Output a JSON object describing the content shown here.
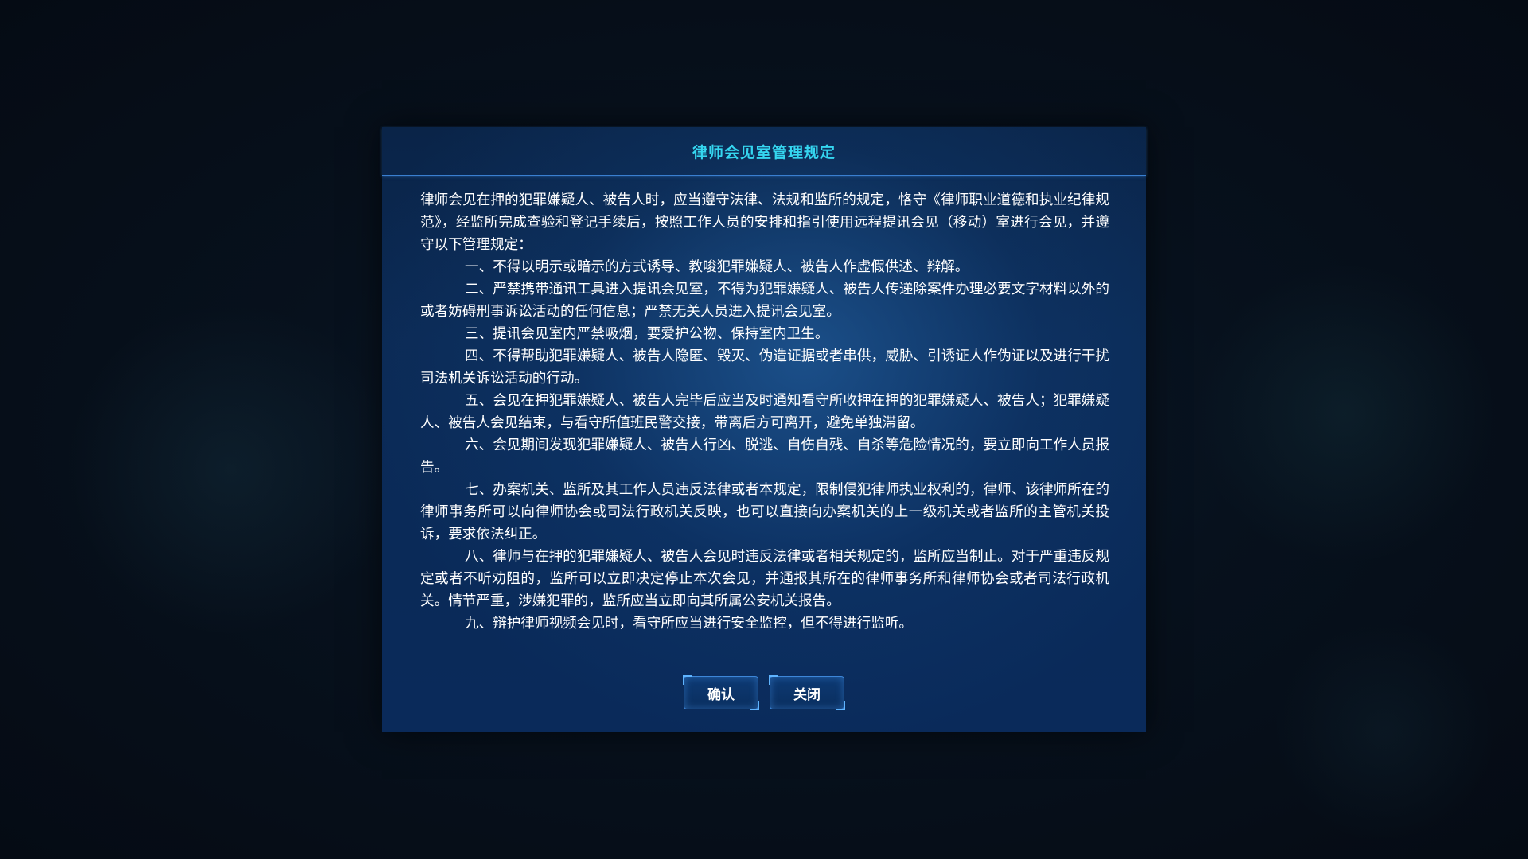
{
  "dialog": {
    "title": "律师会见室管理规定",
    "intro": "律师会见在押的犯罪嫌疑人、被告人时，应当遵守法律、法规和监所的规定，恪守《律师职业道德和执业纪律规范》，经监所完成查验和登记手续后，按照工作人员的安排和指引使用远程提讯会见（移动）室进行会见，并遵守以下管理规定：",
    "rules": [
      "一、不得以明示或暗示的方式诱导、教唆犯罪嫌疑人、被告人作虚假供述、辩解。",
      "二、严禁携带通讯工具进入提讯会见室，不得为犯罪嫌疑人、被告人传递除案件办理必要文字材料以外的或者妨碍刑事诉讼活动的任何信息；严禁无关人员进入提讯会见室。",
      "三、提讯会见室内严禁吸烟，要爱护公物、保持室内卫生。",
      "四、不得帮助犯罪嫌疑人、被告人隐匿、毁灭、伪造证据或者串供，威胁、引诱证人作伪证以及进行干扰司法机关诉讼活动的行动。",
      "五、会见在押犯罪嫌疑人、被告人完毕后应当及时通知看守所收押在押的犯罪嫌疑人、被告人；犯罪嫌疑人、被告人会见结束，与看守所值班民警交接，带离后方可离开，避免单独滞留。",
      "六、会见期间发现犯罪嫌疑人、被告人行凶、脱逃、自伤自残、自杀等危险情况的，要立即向工作人员报告。",
      "七、办案机关、监所及其工作人员违反法律或者本规定，限制侵犯律师执业权利的，律师、该律师所在的律师事务所可以向律师协会或司法行政机关反映，也可以直接向办案机关的上一级机关或者监所的主管机关投诉，要求依法纠正。",
      "八、律师与在押的犯罪嫌疑人、被告人会见时违反法律或者相关规定的，监所应当制止。对于严重违反规定或者不听劝阻的，监所可以立即决定停止本次会见，并通报其所在的律师事务所和律师协会或者司法行政机关。情节严重，涉嫌犯罪的，监所应当立即向其所属公安机关报告。",
      "九、辩护律师视频会见时，看守所应当进行安全监控，但不得进行监听。"
    ],
    "buttons": {
      "confirm_label": "确认",
      "close_label": "关闭"
    }
  },
  "colors": {
    "title": "#35d6f0",
    "text": "#ffffff",
    "dialog_bg": "#0b2a55",
    "button_border": "#3d86d8",
    "page_bg": "#07111d"
  }
}
